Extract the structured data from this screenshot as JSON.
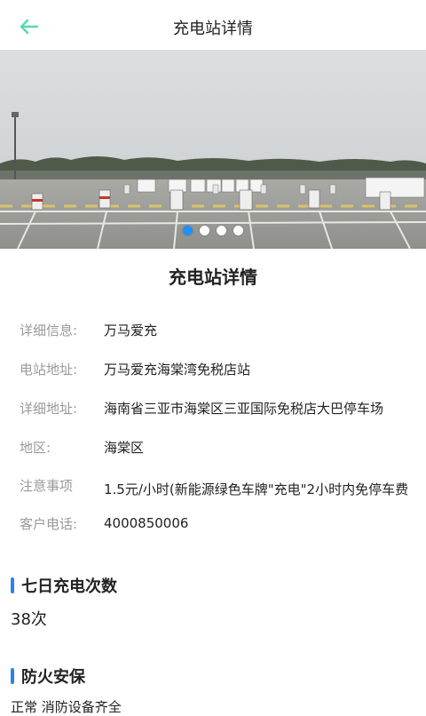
{
  "header": {
    "title": "充电站详情",
    "back_icon": "arrow-left-icon",
    "accent": "#5cd6b0"
  },
  "banner": {
    "slide_count": 4,
    "active_index": 0,
    "active_color": "#1e90ff"
  },
  "details": {
    "title": "充电站详情",
    "rows": [
      {
        "label": "详细信息:",
        "value": "万马爱充"
      },
      {
        "label": "电站地址:",
        "value": "万马爱充海棠湾免税店站"
      },
      {
        "label": "详细地址:",
        "value": "海南省三亚市海棠区三亚国际免税店大巴停车场"
      },
      {
        "label": "地区:",
        "value": "海棠区"
      },
      {
        "label": "注意事项",
        "value": "1.5元/小时(新能源绿色车牌\"充电\"2小时内免停车费"
      },
      {
        "label": "客户电话:",
        "value": "4000850006"
      }
    ]
  },
  "weekly": {
    "title": "七日充电次数",
    "value": "38次"
  },
  "fire": {
    "title": "防火安保",
    "value": "正常 消防设备齐全"
  },
  "colors": {
    "section_bar": "#2f7ff5",
    "label": "#999999"
  }
}
